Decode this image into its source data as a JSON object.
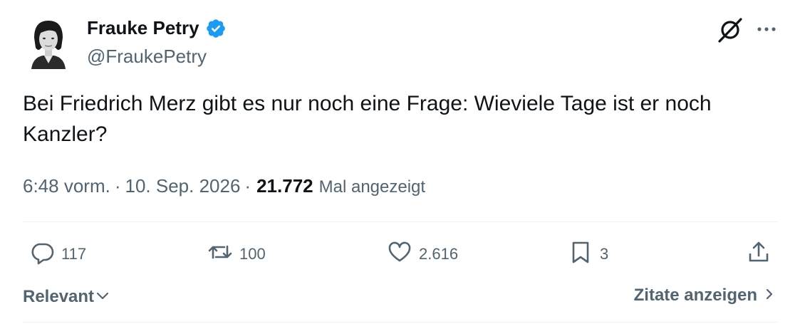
{
  "author": {
    "name": "Frauke Petry",
    "handle": "@FraukePetry"
  },
  "tweet": {
    "text": "Bei Friedrich Merz gibt es nur noch eine Frage: Wieviele Tage ist er noch Kanzler?"
  },
  "meta": {
    "time": "6:48 vorm.",
    "separator1": "·",
    "date": "10. Sep. 2026",
    "separator2": "·",
    "views": "21.772",
    "views_label": "Mal angezeigt"
  },
  "actions": {
    "replies": "117",
    "reposts": "100",
    "likes": "2.616",
    "bookmarks": "3"
  },
  "footer": {
    "sort_label": "Relevant",
    "quotes_label": "Zitate anzeigen"
  },
  "colors": {
    "verified_blue": "#1d9bf0",
    "text_primary": "#0f1419",
    "text_secondary": "#536471",
    "divider": "#eff3f4"
  },
  "icons": {
    "verified": "verified-badge-icon",
    "grok": "grok-icon",
    "more": "more-icon",
    "reply": "reply-icon",
    "repost": "repost-icon",
    "like": "heart-icon",
    "bookmark": "bookmark-icon",
    "share": "share-icon",
    "sort": "chevron-down-icon",
    "quotes": "chevron-right-icon"
  }
}
